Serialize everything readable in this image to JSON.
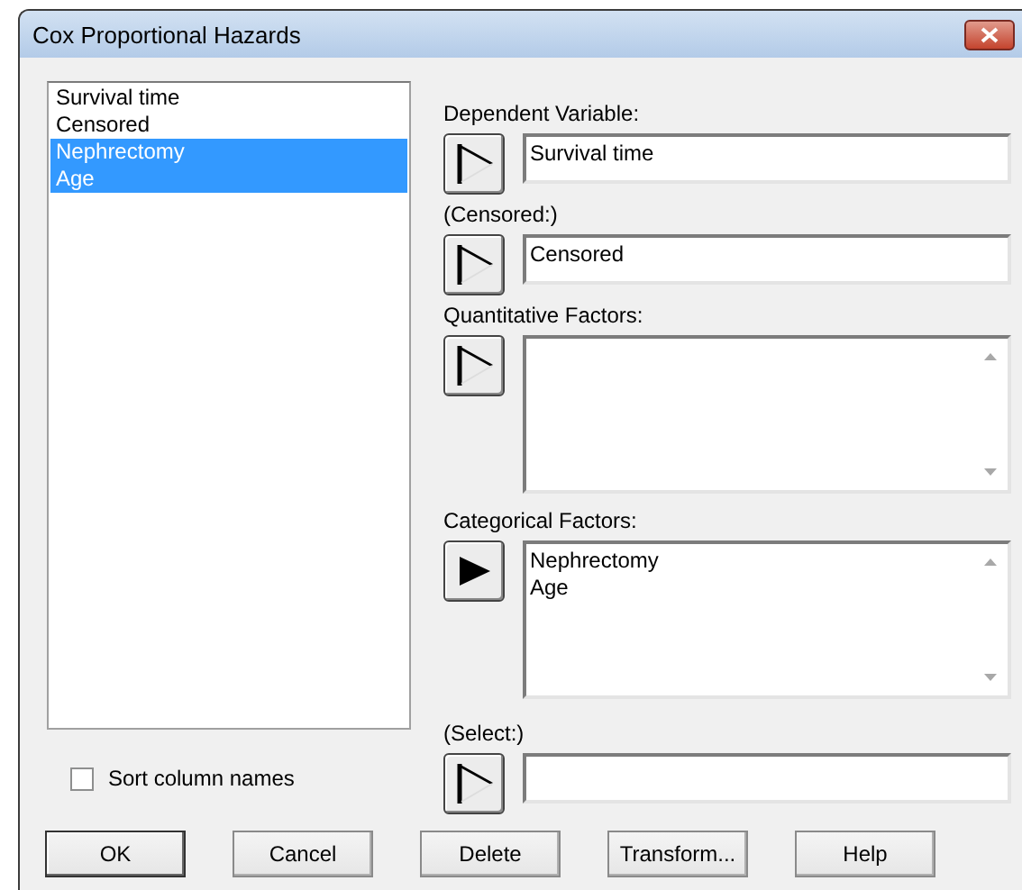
{
  "window": {
    "title": "Cox Proportional Hazards"
  },
  "column_list": {
    "items": [
      {
        "label": "Survival time",
        "selected": false
      },
      {
        "label": "Censored",
        "selected": false
      },
      {
        "label": "Nephrectomy",
        "selected": true
      },
      {
        "label": "Age",
        "selected": true
      }
    ]
  },
  "sort_column_names": {
    "label": "Sort column names",
    "checked": false
  },
  "inputs": [
    {
      "label": "Dependent Variable:",
      "kind": "line",
      "value": "Survival time",
      "arrow_filled": false
    },
    {
      "label": "(Censored:)",
      "kind": "line",
      "value": "Censored",
      "arrow_filled": false
    },
    {
      "label": "Quantitative Factors:",
      "kind": "list",
      "arrow_filled": false
    },
    {
      "label": "Categorical Factors:",
      "kind": "list",
      "values": [
        "Nephrectomy",
        "Age"
      ],
      "arrow_filled": true
    },
    {
      "label": "(Select:)",
      "kind": "line",
      "arrow_filled": false
    }
  ],
  "buttons": [
    {
      "label": "OK",
      "default": true
    },
    {
      "label": "Cancel",
      "default": false
    },
    {
      "label": "Delete",
      "default": false
    },
    {
      "label": "Transform...",
      "default": false
    },
    {
      "label": "Help",
      "default": false
    }
  ]
}
